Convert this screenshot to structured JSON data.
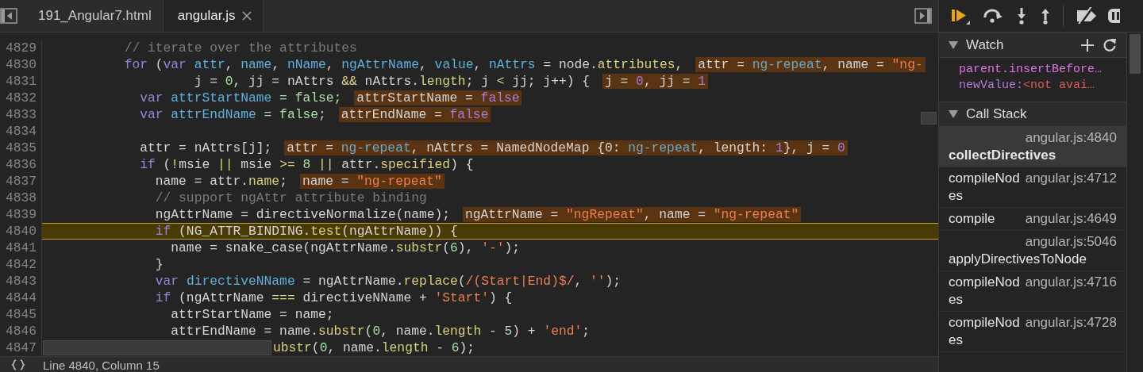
{
  "tabs": [
    {
      "label": "191_Angular7.html",
      "selected": false,
      "closable": false
    },
    {
      "label": "angular.js",
      "selected": true,
      "closable": true
    }
  ],
  "lines": [
    {
      "number": "4829",
      "current": false,
      "tokens": [
        {
          "t": "          // iterate over the attributes",
          "kind": "cm"
        }
      ]
    },
    {
      "number": "4830",
      "current": false,
      "tokens": [
        {
          "t": "          for",
          "kind": "kw"
        },
        {
          "t": " (",
          "kind": "plain"
        },
        {
          "t": "var ",
          "kind": "kw"
        },
        {
          "t": "attr",
          "kind": "def"
        },
        {
          "t": ", ",
          "kind": "plain"
        },
        {
          "t": "name",
          "kind": "def"
        },
        {
          "t": ", ",
          "kind": "plain"
        },
        {
          "t": "nName",
          "kind": "def"
        },
        {
          "t": ", ",
          "kind": "plain"
        },
        {
          "t": "ngAttrName",
          "kind": "def"
        },
        {
          "t": ", ",
          "kind": "plain"
        },
        {
          "t": "value",
          "kind": "def"
        },
        {
          "t": ", ",
          "kind": "plain"
        },
        {
          "t": "nAttrs",
          "kind": "def"
        },
        {
          "t": " = node.",
          "kind": "plain"
        },
        {
          "t": "attributes",
          "kind": "prop"
        },
        {
          "t": ",",
          "kind": "plain"
        }
      ],
      "inline": [
        {
          "t": "attr = ",
          "kind": "plain"
        },
        {
          "t": "ng-repeat",
          "kind": "obj"
        },
        {
          "t": ", name = ",
          "kind": "plain"
        },
        {
          "t": "\"ng-",
          "kind": "str"
        }
      ]
    },
    {
      "number": "4831",
      "current": false,
      "tokens": [
        {
          "t": "                   j = ",
          "kind": "plain"
        },
        {
          "t": "0",
          "kind": "num"
        },
        {
          "t": ", jj = nAttrs ",
          "kind": "plain"
        },
        {
          "t": "&&",
          "kind": "op"
        },
        {
          "t": " nAttrs.",
          "kind": "plain"
        },
        {
          "t": "length",
          "kind": "prop"
        },
        {
          "t": "; j ",
          "kind": "plain"
        },
        {
          "t": "<",
          "kind": "op"
        },
        {
          "t": " jj; j++) {",
          "kind": "plain"
        }
      ],
      "inline": [
        {
          "t": "j = ",
          "kind": "plain"
        },
        {
          "t": "0",
          "kind": "val"
        },
        {
          "t": ", jj = ",
          "kind": "plain"
        },
        {
          "t": "1",
          "kind": "val"
        }
      ]
    },
    {
      "number": "4832",
      "current": false,
      "tokens": [
        {
          "t": "            var ",
          "kind": "kw"
        },
        {
          "t": "attrStartName",
          "kind": "def"
        },
        {
          "t": " = false;",
          "kind": "num"
        }
      ],
      "inline": [
        {
          "t": "attrStartName = ",
          "kind": "plain"
        },
        {
          "t": "false",
          "kind": "val"
        }
      ]
    },
    {
      "number": "4833",
      "current": false,
      "tokens": [
        {
          "t": "            var ",
          "kind": "kw"
        },
        {
          "t": "attrEndName",
          "kind": "def"
        },
        {
          "t": " = false;",
          "kind": "num"
        }
      ],
      "inline": [
        {
          "t": "attrEndName = ",
          "kind": "plain"
        },
        {
          "t": "false",
          "kind": "val"
        }
      ]
    },
    {
      "number": "4834",
      "current": false
    },
    {
      "number": "4835",
      "current": false,
      "tokens": [
        {
          "t": "            attr = nAttrs[j];",
          "kind": "plain"
        }
      ],
      "inline": [
        {
          "t": "attr = ",
          "kind": "plain"
        },
        {
          "t": "ng-repeat",
          "kind": "obj"
        },
        {
          "t": ", nAttrs = NamedNodeMap {0: ",
          "kind": "plain"
        },
        {
          "t": "ng-repeat",
          "kind": "obj"
        },
        {
          "t": ", length: ",
          "kind": "plain"
        },
        {
          "t": "1",
          "kind": "val"
        },
        {
          "t": "}, j = ",
          "kind": "plain"
        },
        {
          "t": "0",
          "kind": "val"
        }
      ]
    },
    {
      "number": "4836",
      "current": false,
      "tokens": [
        {
          "t": "            if",
          "kind": "kw"
        },
        {
          "t": " (",
          "kind": "plain"
        },
        {
          "t": "!",
          "kind": "op"
        },
        {
          "t": "msie ",
          "kind": "plain"
        },
        {
          "t": "||",
          "kind": "op"
        },
        {
          "t": " msie ",
          "kind": "plain"
        },
        {
          "t": ">=",
          "kind": "op"
        },
        {
          "t": " 8",
          "kind": "num"
        },
        {
          "t": " ||",
          "kind": "op"
        },
        {
          "t": " attr.",
          "kind": "plain"
        },
        {
          "t": "specified",
          "kind": "prop"
        },
        {
          "t": ") {",
          "kind": "plain"
        }
      ]
    },
    {
      "number": "4837",
      "current": false,
      "tokens": [
        {
          "t": "              name = attr.",
          "kind": "plain"
        },
        {
          "t": "name",
          "kind": "prop"
        },
        {
          "t": ";",
          "kind": "plain"
        }
      ],
      "inline": [
        {
          "t": "name = ",
          "kind": "plain"
        },
        {
          "t": "\"ng-repeat\"",
          "kind": "str"
        }
      ]
    },
    {
      "number": "4838",
      "current": false,
      "tokens": [
        {
          "t": "              // support ngAttr attribute binding",
          "kind": "cm"
        }
      ]
    },
    {
      "number": "4839",
      "current": false,
      "tokens": [
        {
          "t": "              ngAttrName = directiveNormalize(name);",
          "kind": "plain"
        }
      ],
      "inline": [
        {
          "t": "ngAttrName = ",
          "kind": "plain"
        },
        {
          "t": "\"ngRepeat\"",
          "kind": "str"
        },
        {
          "t": ", name = ",
          "kind": "plain"
        },
        {
          "t": "\"ng-repeat\"",
          "kind": "str"
        }
      ]
    },
    {
      "number": "4840",
      "current": true,
      "tokens": [
        {
          "t": "              if",
          "kind": "kw"
        },
        {
          "t": " (NG_ATTR_BINDING.",
          "kind": "plain"
        },
        {
          "t": "test",
          "kind": "prop"
        },
        {
          "t": "(ngAttrName)) {",
          "kind": "plain"
        }
      ]
    },
    {
      "number": "4841",
      "current": false,
      "tokens": [
        {
          "t": "                name = snake_case(ngAttrName.",
          "kind": "plain"
        },
        {
          "t": "substr",
          "kind": "prop"
        },
        {
          "t": "(",
          "kind": "plain"
        },
        {
          "t": "6",
          "kind": "num"
        },
        {
          "t": "), ",
          "kind": "plain"
        },
        {
          "t": "'-'",
          "kind": "str"
        },
        {
          "t": ");",
          "kind": "plain"
        }
      ]
    },
    {
      "number": "4842",
      "current": false,
      "tokens": [
        {
          "t": "              }",
          "kind": "plain"
        }
      ]
    },
    {
      "number": "4843",
      "current": false,
      "tokens": [
        {
          "t": "              var ",
          "kind": "kw"
        },
        {
          "t": "directiveNName",
          "kind": "def"
        },
        {
          "t": " = ngAttrName.",
          "kind": "plain"
        },
        {
          "t": "replace",
          "kind": "prop"
        },
        {
          "t": "(",
          "kind": "plain"
        },
        {
          "t": "/(Start|End)$/",
          "kind": "str"
        },
        {
          "t": ", ",
          "kind": "plain"
        },
        {
          "t": "''",
          "kind": "str"
        },
        {
          "t": ");",
          "kind": "plain"
        }
      ]
    },
    {
      "number": "4844",
      "current": false,
      "tokens": [
        {
          "t": "              if",
          "kind": "kw"
        },
        {
          "t": " (ngAttrName ",
          "kind": "plain"
        },
        {
          "t": "===",
          "kind": "op"
        },
        {
          "t": " directiveNName + ",
          "kind": "plain"
        },
        {
          "t": "'Start'",
          "kind": "str"
        },
        {
          "t": ") {",
          "kind": "plain"
        }
      ]
    },
    {
      "number": "4845",
      "current": false,
      "tokens": [
        {
          "t": "                attrStartName = name;",
          "kind": "plain"
        }
      ]
    },
    {
      "number": "4846",
      "current": false,
      "tokens": [
        {
          "t": "                attrEndName = name.",
          "kind": "plain"
        },
        {
          "t": "substr",
          "kind": "prop"
        },
        {
          "t": "(",
          "kind": "plain"
        },
        {
          "t": "0",
          "kind": "num"
        },
        {
          "t": ", name.",
          "kind": "plain"
        },
        {
          "t": "length",
          "kind": "prop"
        },
        {
          "t": " - ",
          "kind": "plain"
        },
        {
          "t": "5",
          "kind": "num"
        },
        {
          "t": ") + ",
          "kind": "plain"
        },
        {
          "t": "'end'",
          "kind": "str"
        },
        {
          "t": ";",
          "kind": "plain"
        }
      ]
    },
    {
      "number": "4847",
      "current": false,
      "tokens": [
        {
          "t": "ubstr",
          "kind": "prop"
        },
        {
          "t": "(",
          "kind": "plain"
        },
        {
          "t": "0",
          "kind": "num"
        },
        {
          "t": ", name.",
          "kind": "plain"
        },
        {
          "t": "length",
          "kind": "prop"
        },
        {
          "t": " - ",
          "kind": "plain"
        },
        {
          "t": "6",
          "kind": "num"
        },
        {
          "t": ");",
          "kind": "plain"
        }
      ]
    }
  ],
  "status_bar": {
    "position": "Line 4840, Column 15"
  },
  "watch": {
    "title": "Watch",
    "expanded": true,
    "items": [
      {
        "name": "parent.insertBefore…"
      },
      {
        "name": "newValue:",
        "value": "<not avai…"
      }
    ]
  },
  "call_stack": {
    "title": "Call Stack",
    "expanded": true,
    "frames": [
      {
        "name": "collectDirectives",
        "location": "angular.js:4840",
        "selected": true
      },
      {
        "name": "compileNodes",
        "location": "angular.js:4712",
        "selected": false
      },
      {
        "name": "compile",
        "location": "angular.js:4649",
        "selected": false
      },
      {
        "name": "applyDirectivesToNode",
        "location": "angular.js:5046",
        "selected": false
      },
      {
        "name": "compileNodes",
        "location": "angular.js:4716",
        "selected": false
      },
      {
        "name": "compileNodes",
        "location": "angular.js:4728",
        "selected": false
      }
    ]
  }
}
